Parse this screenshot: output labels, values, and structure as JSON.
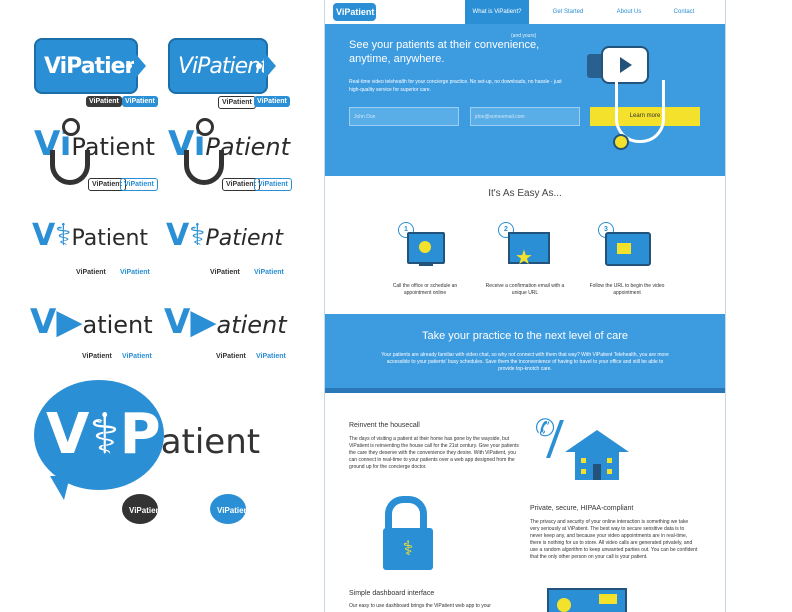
{
  "colors": {
    "brand_blue": "#2a8fd4",
    "hero_blue": "#3d9be0",
    "dark_blue": "#23537a",
    "yellow": "#f4e12c",
    "dark": "#333333"
  },
  "logo": {
    "text": "ViPatient",
    "v": "V",
    "i": "i",
    "rest": "Patient",
    "rest_lower": "atient",
    "mini": "ViPatient"
  },
  "site": {
    "brand": "ViPatient",
    "nav": [
      "What is ViPatient?",
      "Get Started",
      "About Us",
      "Contact"
    ],
    "hero": {
      "aside": "(and yours)",
      "headline": "See your patients at their convenience, anytime, anywhere.",
      "body": "Real-time video telehealth for your concierge practice. No set-up, no downloads, no hassle - just high-quality service for superior care.",
      "name_placeholder": "John Doe",
      "email_placeholder": "jdoe@someemail.com",
      "cta": "Learn more"
    },
    "steps_title": "It's As Easy As...",
    "steps": [
      {
        "num": "1",
        "text": "Call the office or schedule an appointment online"
      },
      {
        "num": "2",
        "text": "Receive a confirmation email with a unique URL"
      },
      {
        "num": "3",
        "text": "Follow the URL to begin the video appointment"
      }
    ],
    "band": {
      "title": "Take your practice to the next level of care",
      "body": "Your patients are already familiar with video chat, so why not connect with them that way? With ViPatient Telehealth, you are more accessible to your patients' busy schedules. Save them the inconvenience of having to travel to your office and still be able to provide top-knotch care."
    },
    "features": [
      {
        "title": "Reinvent the housecall",
        "body": "The days of visiting a patient at their home has gone by the wayside, but ViPatient is reinventing the house call for the 21st century. Give your patients the care they deserve with the convenience they desire. With ViPatient, you can connect in real-time to your patients over a web app designed from the ground up for the concierge doctor."
      },
      {
        "title": "Private, secure, HIPAA-compliant",
        "body": "The privacy and security of your online interaction is something we take very seriously at ViPatient. The best way to secure sensitive data is to never keep any, and because your video appointments are in real-time, there is nothing for us to store. All video calls are generated privately, and use a random algorithm to keep unwanted parties out. You can be confident that the only other person on your call is your patient."
      },
      {
        "title": "Simple dashboard interface",
        "body": "Our easy to use dashboard brings the ViPatient web app to your"
      }
    ]
  }
}
